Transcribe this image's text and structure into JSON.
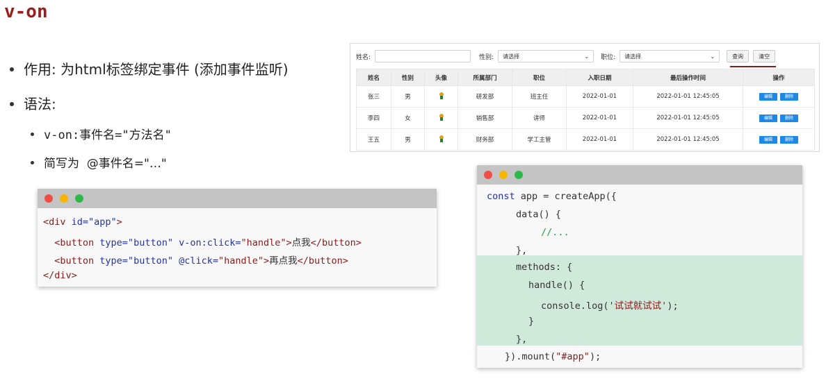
{
  "slide": {
    "title": "v-on",
    "bullet1": "作用: 为html标签绑定事件 (添加事件监听)",
    "bullet2": "语法:",
    "sub1": "v-on:事件名=\"方法名\"",
    "sub2": "简写为  @事件名=\"…\""
  },
  "table_panel": {
    "filters": {
      "name_label": "姓名:",
      "name_value": "",
      "gender_label": "性别:",
      "gender_select": "请选择",
      "job_label": "职位:",
      "job_select": "请选择",
      "query_button": "查询",
      "clear_button": "清空"
    },
    "columns": [
      "姓名",
      "性别",
      "头像",
      "所属部门",
      "职位",
      "入职日期",
      "最后操作时间",
      "操作"
    ],
    "rows": [
      {
        "name": "张三",
        "gender": "男",
        "dept": "研发部",
        "job": "班主任",
        "date": "2022-01-01",
        "updated": "2022-01-01 12:45:05"
      },
      {
        "name": "李四",
        "gender": "女",
        "dept": "销售部",
        "job": "讲师",
        "date": "2022-01-01",
        "updated": "2022-01-01 12:45:05"
      },
      {
        "name": "王五",
        "gender": "男",
        "dept": "财务部",
        "job": "学工主管",
        "date": "2022-01-01",
        "updated": "2022-01-01 12:45:05"
      }
    ],
    "edit_label": "编辑",
    "delete_label": "删除",
    "accent_color": "#8a1a1a",
    "button_color": "#1e88e5"
  },
  "code_left": {
    "lines": [
      {
        "t1": "<div ",
        "a1": "id=",
        "s1": "\"app\"",
        "t2": ">"
      },
      {
        "indent": "  ",
        "t1": "<button ",
        "a1": "type=",
        "s1": "\"button\"",
        "a2": " v-on:click=",
        "s2": "\"handle\"",
        "t2": ">",
        "text": "点我",
        "t3": "</button>"
      },
      {
        "indent": "  ",
        "t1": "<button ",
        "a1": "type=",
        "s1": "\"button\"",
        "a2": " @click=",
        "s2": "\"handle\"",
        "t2": ">",
        "text": "再点我",
        "t3": "</button>"
      },
      {
        "t1": "</div>"
      }
    ]
  },
  "code_right": {
    "l1_kw": "const",
    "l1_rest": " app = createApp({",
    "l2": "data() {",
    "l3": "//...",
    "l4": "},",
    "l5": "methods: {",
    "l6": "handle() {",
    "l7_a": "console.log(",
    "l7_s": "'试试就试试'",
    "l7_b": ");",
    "l8": "}",
    "l9": "},",
    "l10_a": "}).mount(",
    "l10_s": "\"#app\"",
    "l10_b": ");",
    "highlight_color": "#cfe9da"
  }
}
